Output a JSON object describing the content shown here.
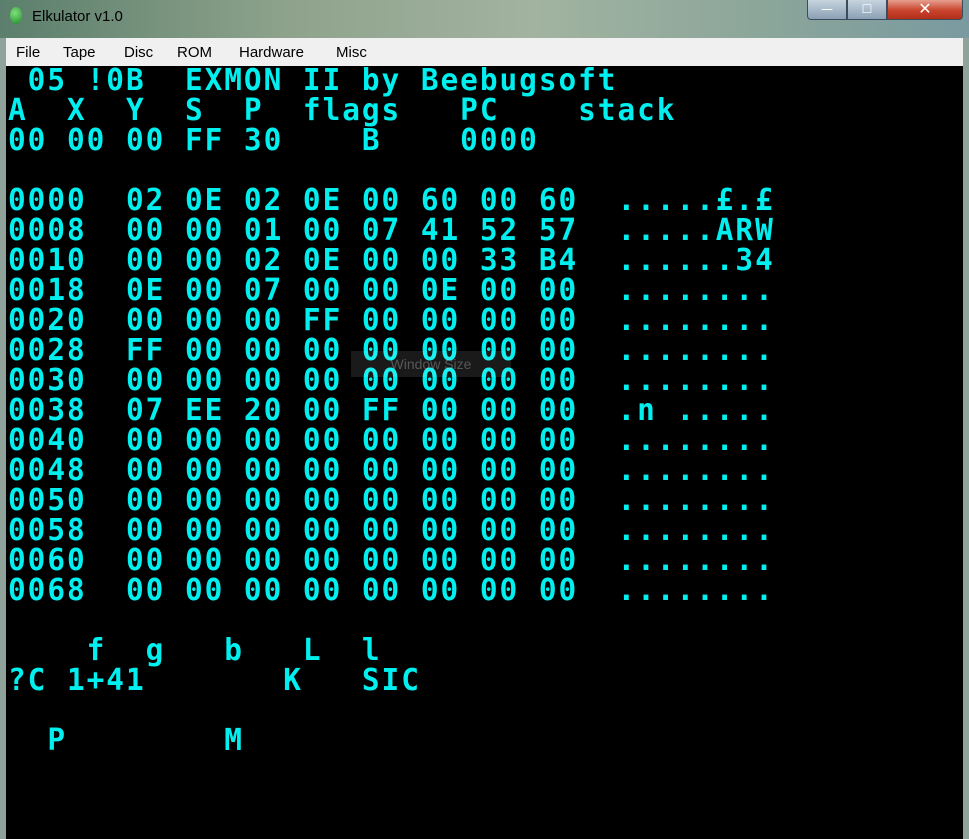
{
  "window": {
    "title": "Elkulator v1.0",
    "minimize_glyph": "—",
    "maximize_glyph": "☐",
    "close_glyph": "✕",
    "icon": "green-leaf-icon"
  },
  "menubar": {
    "items": [
      "File",
      "Tape",
      "Disc",
      "ROM",
      "Hardware",
      "Misc"
    ]
  },
  "screen": {
    "color": "#00f0f0",
    "lines": [
      " 05 !0B  EXMON II by Beebugsoft",
      "A  X  Y  S  P  flags   PC    stack",
      "00 00 00 FF 30    B    0000",
      "",
      "0000  02 0E 02 0E 00 60 00 60  .....£.£",
      "0008  00 00 01 00 07 41 52 57  .....ARW",
      "0010  00 00 02 0E 00 00 33 B4  ......34",
      "0018  0E 00 07 00 00 0E 00 00  ........",
      "0020  00 00 00 FF 00 00 00 00  ........",
      "0028  FF 00 00 00 00 00 00 00  ........",
      "0030  00 00 00 00 00 00 00 00  ........",
      "0038  07 EE 20 00 FF 00 00 00  .n .....",
      "0040  00 00 00 00 00 00 00 00  ........",
      "0048  00 00 00 00 00 00 00 00  ........",
      "0050  00 00 00 00 00 00 00 00  ........",
      "0058  00 00 00 00 00 00 00 00  ........",
      "0060  00 00 00 00 00 00 00 00  ........",
      "0068  00 00 00 00 00 00 00 00  ........",
      "",
      "    f  g   b   L  l",
      "?C 1+41       K   SIC",
      "",
      "  P        M"
    ],
    "overlay_text": "Window Size"
  }
}
